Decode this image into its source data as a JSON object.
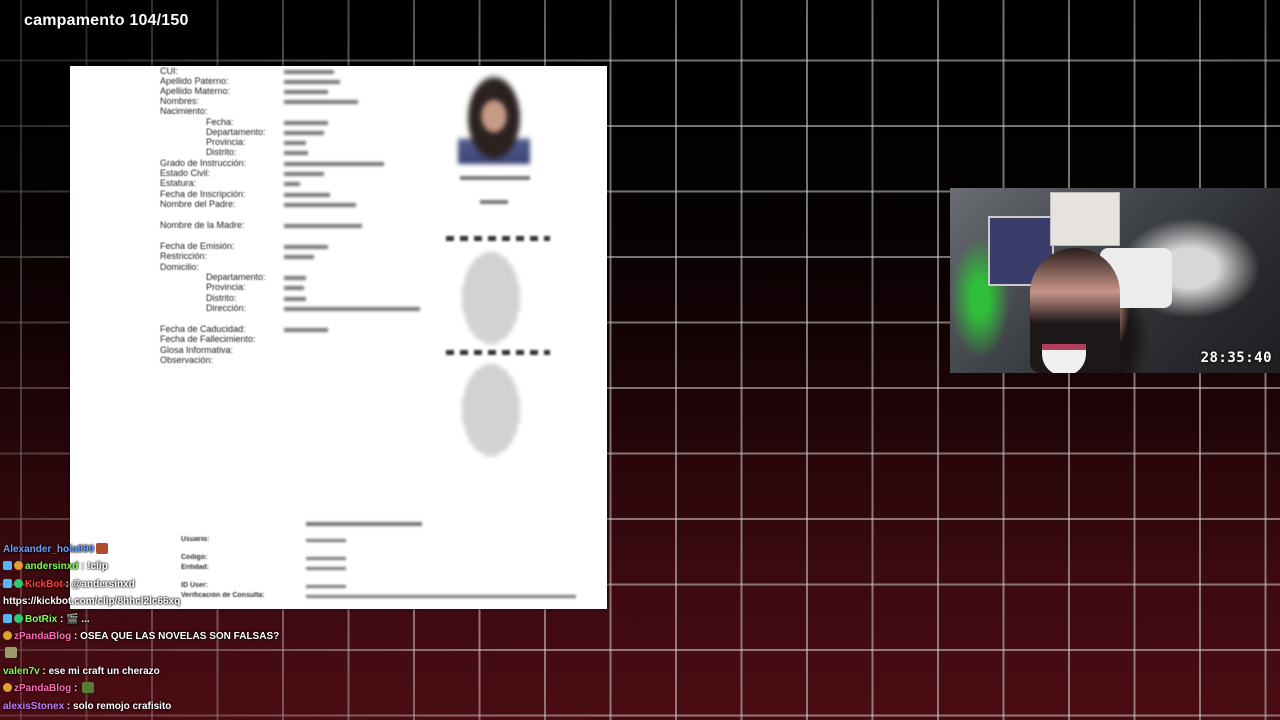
{
  "overlay": {
    "title": "campamento 104/150"
  },
  "document": {
    "left_fields": [
      "CUI:",
      "Apellido Paterno:",
      "Apellido Materno:",
      "Nombres:",
      "Nacimiento:",
      "Fecha:",
      "Departamento:",
      "Provincia:",
      "Distrito:",
      "Grado de Instrucción:",
      "Estado Civil:",
      "Estatura:",
      "Fecha de Inscripción:",
      "Nombre del Padre:",
      "Nombre de la Madre:",
      "Fecha de Emisión:",
      "Restricción:",
      "Domicilio:",
      "Departamento:",
      "Provincia:",
      "Distrito:",
      "Dirección:",
      "Fecha de Caducidad:",
      "Fecha de Fallecimiento:",
      "Glosa Informativa:",
      "Observación:"
    ],
    "footer_fields": [
      "Usuario:",
      "Codigo:",
      "Entidad:",
      "ID User:",
      "Verificación de Consulta:"
    ]
  },
  "webcam": {
    "timer": "28:35:40"
  },
  "chat": {
    "messages": [
      {
        "user": "Alexander_hola890",
        "color": "#6aa0ff",
        "badges": [],
        "text": "",
        "emote": "#b14a2e"
      },
      {
        "user": "andersinxd",
        "color": "#7cff54",
        "badges": [
          "kick",
          "og"
        ],
        "text": " : !clip",
        "emote": ""
      },
      {
        "user": "KickBot",
        "color": "#ff3b3b",
        "badges": [
          "kick",
          "ok"
        ],
        "text": " : @andersinxd",
        "emote": ""
      },
      {
        "user": "",
        "color": "#ffffff",
        "badges": [],
        "text": "https://kickbot.com/clip/8hhcl2lc66xq",
        "emote": ""
      },
      {
        "user": "BotRix",
        "color": "#7cff54",
        "badges": [
          "kick",
          "ok"
        ],
        "text": " : 🎬 ...",
        "emote": ""
      },
      {
        "user": "zPandaBlog",
        "color": "#ff6eb4",
        "badges": [
          "og"
        ],
        "text": " : OSEA QUE LAS NOVELAS SON FALSAS?",
        "emote": ""
      },
      {
        "user": "",
        "color": "#ffffff",
        "badges": [],
        "text": "",
        "emote": "#9c9c6a"
      },
      {
        "user": "valen7v",
        "color": "#7cff54",
        "badges": [],
        "text": " : ese mi craft un cherazo",
        "emote": ""
      },
      {
        "user": "zPandaBlog",
        "color": "#ff6eb4",
        "badges": [
          "og"
        ],
        "text": " : ",
        "emote": "#5a7a3a"
      },
      {
        "user": "alexisStonex",
        "color": "#c77dff",
        "badges": [],
        "text": " : solo remojo crafisito",
        "emote": ""
      }
    ]
  }
}
